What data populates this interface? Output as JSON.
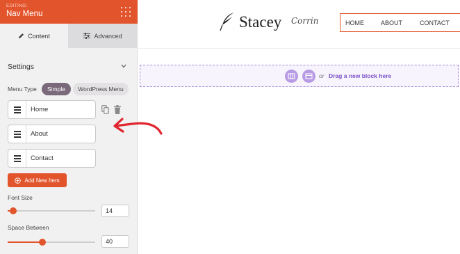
{
  "sidebar": {
    "editing_label": "EDITING:",
    "title": "Nav Menu",
    "tabs": [
      {
        "label": "Content",
        "icon": "pencil-icon",
        "active": true
      },
      {
        "label": "Advanced",
        "icon": "sliders-icon",
        "active": false
      }
    ],
    "settings_heading": "Settings",
    "menu_type": {
      "label": "Menu Type",
      "options": [
        "Simple",
        "WordPress Menu"
      ],
      "selected": "Simple"
    },
    "menu_items": [
      {
        "label": "Home"
      },
      {
        "label": "About"
      },
      {
        "label": "Contact"
      }
    ],
    "add_button": "Add New Item",
    "font_size": {
      "label": "Font Size",
      "value": "14",
      "slider_fraction": 0.06
    },
    "space_between": {
      "label": "Space Between",
      "value": "40",
      "slider_fraction": 0.4
    }
  },
  "canvas": {
    "logo": {
      "name": "Stacey",
      "surname": "Corrin"
    },
    "nav_items": [
      "HOME",
      "ABOUT",
      "CONTACT"
    ],
    "drop_zone": {
      "or_text": "or",
      "drag_text": "Drag a new block here"
    }
  },
  "colors": {
    "accent": "#e2542c",
    "purple": "#7c52c9",
    "pill_active": "#79697a"
  }
}
